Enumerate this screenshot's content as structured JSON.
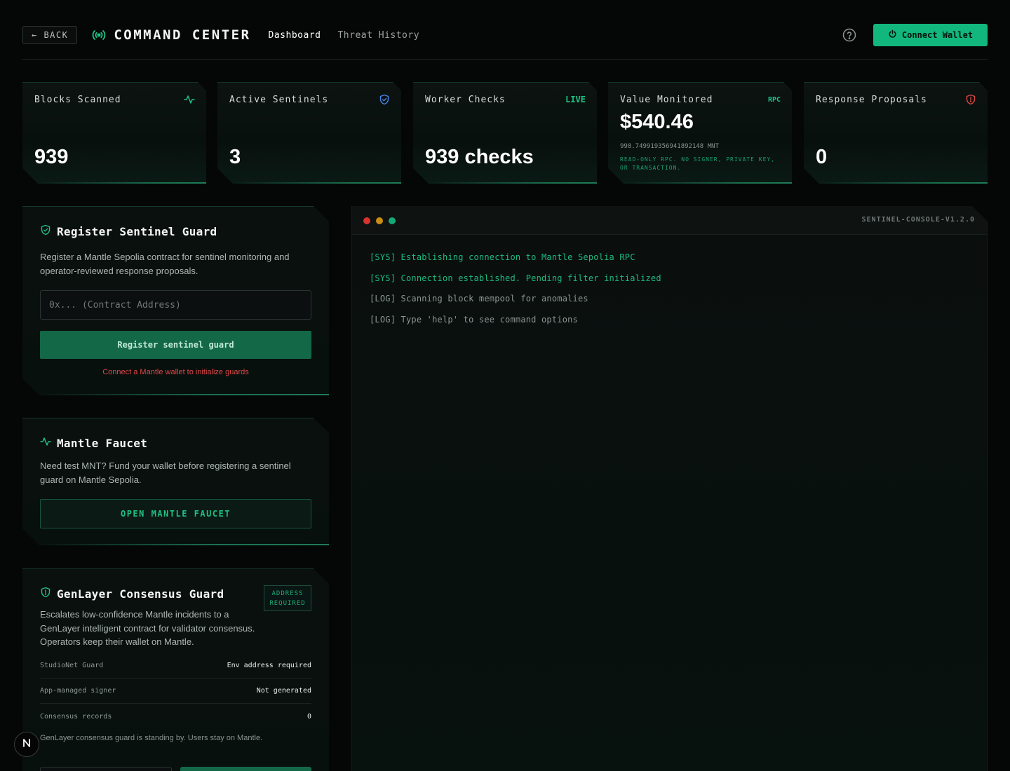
{
  "header": {
    "back_label": "← BACK",
    "title": "COMMAND CENTER",
    "nav": [
      {
        "label": "Dashboard",
        "active": true
      },
      {
        "label": "Threat History",
        "active": false
      }
    ],
    "connect_label": "Connect Wallet"
  },
  "stats": {
    "blocks": {
      "label": "Blocks Scanned",
      "value": "939",
      "icon": "activity-icon"
    },
    "sentinels": {
      "label": "Active Sentinels",
      "value": "3",
      "icon": "shield-check-icon"
    },
    "worker": {
      "label": "Worker Checks",
      "badge": "LIVE",
      "value": "939 checks"
    },
    "value": {
      "label": "Value Monitored",
      "badge": "RPC",
      "value": "$540.46",
      "sub": "998.749919356941892148 MNT",
      "note": "READ-ONLY RPC. NO SIGNER, PRIVATE KEY, OR TRANSACTION."
    },
    "proposals": {
      "label": "Response Proposals",
      "value": "0",
      "icon": "alert-shield-icon"
    }
  },
  "register": {
    "title": "Register Sentinel Guard",
    "desc": "Register a Mantle Sepolia contract for sentinel monitoring and operator-reviewed response proposals.",
    "placeholder": "0x... (Contract Address)",
    "button": "Register sentinel guard",
    "warning": "Connect a Mantle wallet to initialize guards"
  },
  "faucet": {
    "title": "Mantle Faucet",
    "desc": "Need test MNT? Fund your wallet before registering a sentinel guard on Mantle Sepolia.",
    "button": "OPEN MANTLE FAUCET"
  },
  "genlayer": {
    "title": "GenLayer Consensus Guard",
    "badge_line1": "ADDRESS",
    "badge_line2": "REQUIRED",
    "desc": "Escalates low-confidence Mantle incidents to a GenLayer intelligent contract for validator consensus. Operators keep their wallet on Mantle.",
    "rows": [
      {
        "key": "StudioNet Guard",
        "value": "Env address required"
      },
      {
        "key": "App-managed signer",
        "value": "Not generated"
      },
      {
        "key": "Consensus records",
        "value": "0"
      }
    ],
    "standby": "GenLayer consensus guard is standing by. Users stay on Mantle."
  },
  "console": {
    "name": "SENTINEL-CONSOLE-V1.2.0",
    "lines": [
      {
        "text": "[SYS] Establishing connection to Mantle Sepolia RPC",
        "kind": "sys"
      },
      {
        "text": "[SYS] Connection established. Pending filter initialized",
        "kind": "sys"
      },
      {
        "text": "[LOG] Scanning block mempool for anomalies",
        "kind": "log"
      },
      {
        "text": "[LOG] Type 'help' to see command options",
        "kind": "log"
      }
    ]
  },
  "colors": {
    "accent": "#12b77d",
    "danger": "#e04747",
    "background": "#050707"
  }
}
